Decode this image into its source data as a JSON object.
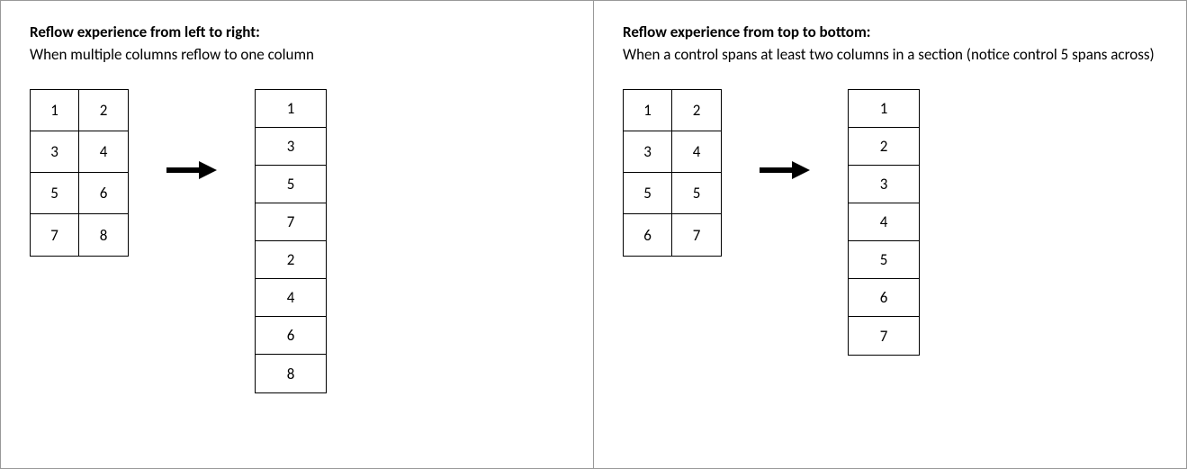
{
  "left": {
    "heading": "Reflow experience from left to right:",
    "subheading": "When multiple columns reflow to one column",
    "grid": [
      [
        "1",
        "2"
      ],
      [
        "3",
        "4"
      ],
      [
        "5",
        "6"
      ],
      [
        "7",
        "8"
      ]
    ],
    "column": [
      "1",
      "3",
      "5",
      "7",
      "2",
      "4",
      "6",
      "8"
    ]
  },
  "right": {
    "heading": "Reflow experience from top to bottom:",
    "subheading": "When a control spans at least two columns in a section (notice control 5 spans across)",
    "grid": [
      [
        "1",
        "2"
      ],
      [
        "3",
        "4"
      ],
      [
        "5",
        "5"
      ],
      [
        "6",
        "7"
      ]
    ],
    "column": [
      "1",
      "2",
      "3",
      "4",
      "5",
      "6",
      "7"
    ]
  }
}
